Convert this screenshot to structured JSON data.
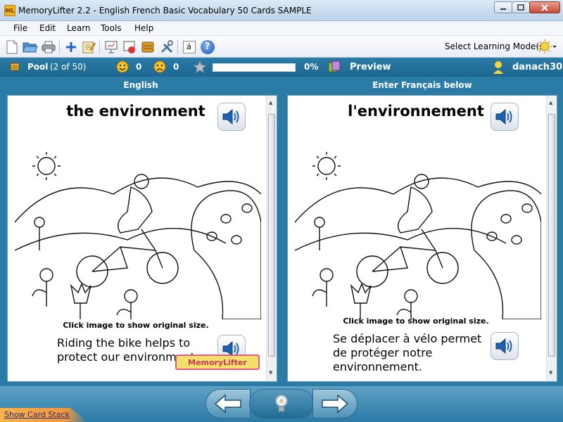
{
  "window": {
    "app_icon_text": "ML",
    "title": "MemoryLifter 2.2 - English French Basic Vocabulary 50 Cards SAMPLE"
  },
  "menu": [
    "File",
    "Edit",
    "Learn",
    "Tools",
    "Help"
  ],
  "toolbar": {
    "icons": [
      "new-file-icon",
      "open-folder-icon",
      "print-icon",
      "add-card-icon",
      "edit-card-icon",
      "presentation-icon",
      "statistics-icon",
      "card-box-icon",
      "settings-tools-icon",
      "special-character-icon",
      "help-icon"
    ],
    "special_char_label": "á",
    "help_label": "?",
    "mode_label": "Select Learning Mode(s)"
  },
  "status": {
    "pool_label": "Pool",
    "pool_count": "(2 of 50)",
    "correct_count": "0",
    "wrong_count": "0",
    "progress_percent": 0,
    "progress_label": "0%",
    "preview_label": "Preview",
    "user": "danach30"
  },
  "question": {
    "heading": "English",
    "word": "the environment",
    "image_hint": "Click image to show original size.",
    "sentence": "Riding the bike helps to protect our environment.",
    "watermark": "MemoryLifter"
  },
  "answer": {
    "heading": "Enter Français below",
    "word": "l'environnement",
    "image_hint": "Click image to show original size.",
    "sentence": "Se déplacer à vélo permet de protéger notre environnement."
  },
  "bottom": {
    "show_stack": "Show Card Stack"
  },
  "colors": {
    "accent": "#2a7ba6",
    "status_bar": "#1c6790",
    "nav_button": "#4f93b9",
    "stack_tab": "#f0963a"
  }
}
